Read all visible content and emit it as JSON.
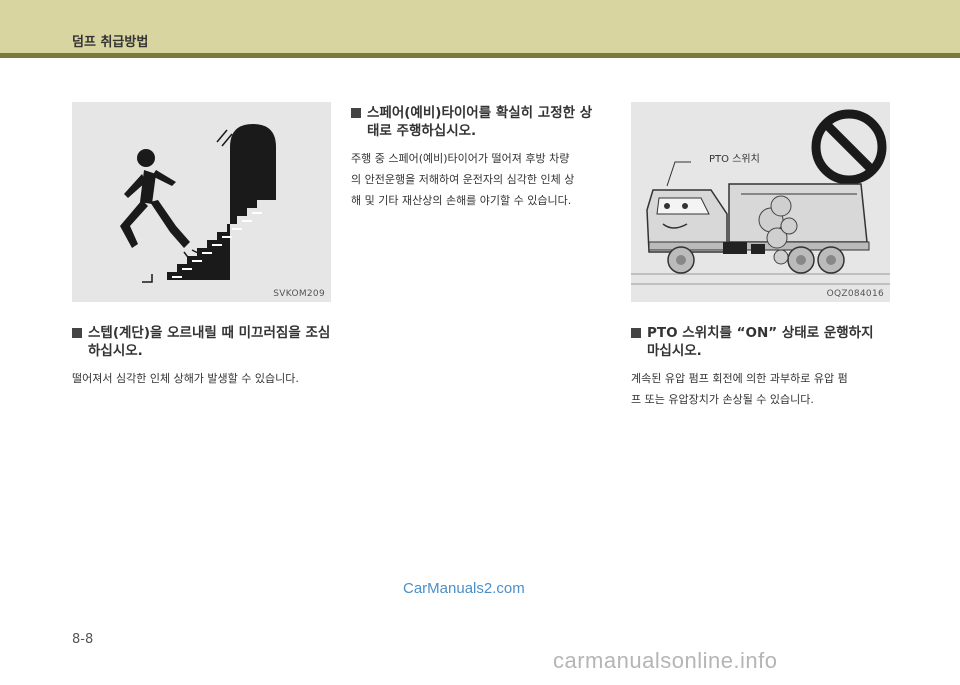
{
  "header": {
    "title": "덤프 취급방법"
  },
  "figures": {
    "stairs": {
      "code": "SVKOM209"
    },
    "pto": {
      "code": "OQZ084016",
      "label": "PTO 스위치"
    }
  },
  "sections": {
    "stairs": {
      "title_line1": "스텝(계단)을 오르내릴 때 미끄러짐을 조심",
      "title_line2": "하십시오.",
      "body_line1": "떨어져서 심각한 인체 상해가 발생할 수 있습니다."
    },
    "spare_tire": {
      "title_line1": "스페어(예비)타이어를 확실히 고정한 상",
      "title_line2": "태로 주행하십시오.",
      "body_line1": "주행 중 스페어(예비)타이어가 떨어져 후방 차량",
      "body_line2": "의 안전운행을 저해하여 운전자의 심각한 인체 상",
      "body_line3": "해 및 기타 재산상의 손해를 야기할 수 있습니다."
    },
    "pto": {
      "title_line1": "PTO 스위치를 “ON” 상태로 운행하지",
      "title_line2": "마십시오.",
      "body_line1": "계속된 유압 펌프 회전에 의한 과부하로 유압 펌",
      "body_line2": "프 또는 유압장치가 손상될 수 있습니다."
    }
  },
  "watermark": "CarManuals2.com",
  "footer_watermark": "carmanualsonline.info",
  "page_number": "8-8"
}
